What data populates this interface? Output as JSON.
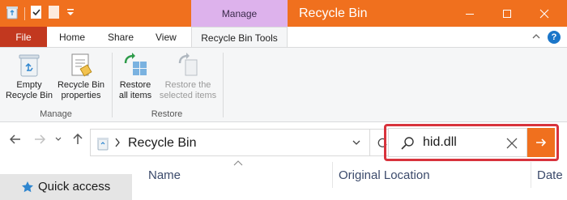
{
  "window": {
    "context_tab": "Manage",
    "title": "Recycle Bin"
  },
  "ribbon_tabs": {
    "file": "File",
    "home": "Home",
    "share": "Share",
    "view": "View",
    "active": "Recycle Bin Tools"
  },
  "ribbon": {
    "empty": "Empty\nRecycle Bin",
    "properties": "Recycle Bin\nproperties",
    "restore_all": "Restore\nall items",
    "restore_selected": "Restore the\nselected items",
    "group_manage": "Manage",
    "group_restore": "Restore"
  },
  "address": {
    "path": "Recycle Bin"
  },
  "search": {
    "query": "hid.dll"
  },
  "navigation": {
    "quick_access": "Quick access"
  },
  "columns": {
    "name": "Name",
    "original_location": "Original Location",
    "date": "Date"
  },
  "colors": {
    "accent": "#f0701e",
    "file_tab": "#c2381f",
    "context_tab": "#ddb2ec",
    "highlight": "#d8333c"
  }
}
